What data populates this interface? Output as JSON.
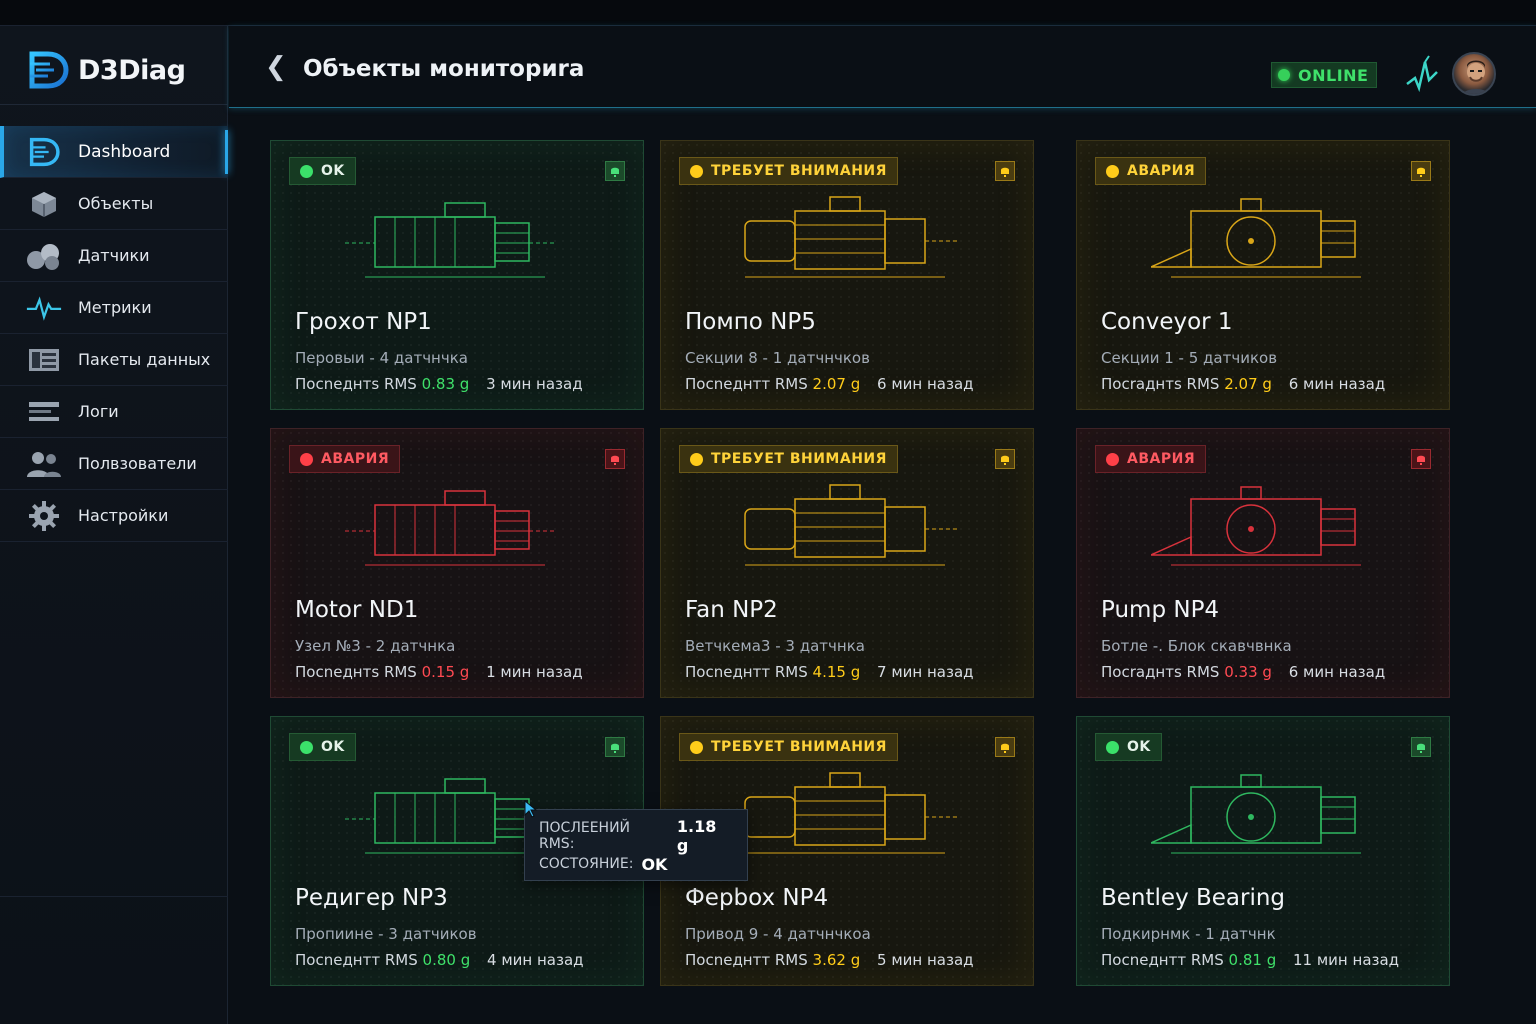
{
  "app": {
    "logo_text": "D3Diag"
  },
  "sidebar": {
    "items": [
      {
        "label": "Dashboard",
        "icon": "logo-d-icon",
        "active": true
      },
      {
        "label": "Объекты",
        "icon": "cube-icon"
      },
      {
        "label": "Датчики",
        "icon": "sensors-icon"
      },
      {
        "label": "Метрики",
        "icon": "pulse-icon"
      },
      {
        "label": "Пакеты данных",
        "icon": "data-packets-icon"
      },
      {
        "label": "Логи",
        "icon": "logs-icon"
      },
      {
        "label": "Полвзователи",
        "icon": "users-icon"
      },
      {
        "label": "Настройки",
        "icon": "gear-icon"
      }
    ]
  },
  "header": {
    "title": "Объекты мониториrа",
    "status": "ONLINE"
  },
  "colors": {
    "ok": "#3fe06a",
    "warn": "#ffcc1a",
    "alarm": "#ff4a52",
    "accent": "#2aa7e8"
  },
  "cards": [
    {
      "status": "ok",
      "badge": "OK",
      "title": "Грохот NP1",
      "meta": "Перовыи  -  4 датчнчка",
      "rms_label": "Посnеднтs RMS",
      "rms_value": "0.83  g",
      "ago": "3 мин назад"
    },
    {
      "status": "warn",
      "badge": "ТРЕБУЕТ ВНИМАНИЯ",
      "title": "Помпо NP5",
      "meta": "Секции 8  -  1 датчнчков",
      "rms_label": "Посnеднтт RMS",
      "rms_value": "2.07  g",
      "ago": "6 мин назад"
    },
    {
      "status": "warn",
      "badge": "АВАРИЯ",
      "title": "Conveyor 1",
      "meta": "Секции 1  -  5 датчиков",
      "rms_label": "Посrаднтs RMS",
      "rms_value": "2.07  g",
      "ago": "6 мин назад"
    },
    {
      "status": "alarm",
      "badge": "АВАРИЯ",
      "title": "Motor ND1",
      "meta": "Узел  №3  -  2 датчнка",
      "rms_label": "Посnеднтs RMS",
      "rms_value": "0.15  g",
      "ago": "1 мин назад"
    },
    {
      "status": "warn",
      "badge": "ТРЕБУЕТ ВНИМАНИЯ",
      "title": "Fan NP2",
      "meta": "Ветчкема3  -  3 датчнка",
      "rms_label": "Посnеднтт RMS",
      "rms_value": "4.15  g",
      "ago": "7 мин назад"
    },
    {
      "status": "alarm",
      "badge": "АВАРИЯ",
      "title": "Pump NP4",
      "meta": "Ботле  -. Блок скавчвнка",
      "rms_label": "Посrаднтs RMS",
      "rms_value": "0.33  g",
      "ago": "6 мин назад"
    },
    {
      "status": "ok",
      "badge": "OK",
      "title": "Редигер NP3",
      "meta": "Пропиине  -  3 датчиков",
      "rms_label": "Посnеднтт RMS",
      "rms_value": "0.80  g",
      "ago": "4 мин назад"
    },
    {
      "status": "warn",
      "badge": "ТРЕБУЕТ ВНИМАНИЯ",
      "title": "Ферbox NP4",
      "meta": "Привод 9  -  4 датчнчкоа",
      "rms_label": "Посnеднтт RMS",
      "rms_value": "3.62  g",
      "ago": "5 мин назад"
    },
    {
      "status": "ok",
      "badge": "OK",
      "title": "Bentley Bearing",
      "meta": "Подкирнмк - 1 датчнк",
      "rms_label": "Посnеднтт RMS",
      "rms_value": "0.81  g",
      "ago": "11 мин назад"
    }
  ],
  "tooltip": {
    "rms_label": "ПОСЛЕЕНИЙ RMS:",
    "rms_value": "1.18 g",
    "state_label": "СОСТОЯНИЕ:",
    "state_value": "OK"
  }
}
